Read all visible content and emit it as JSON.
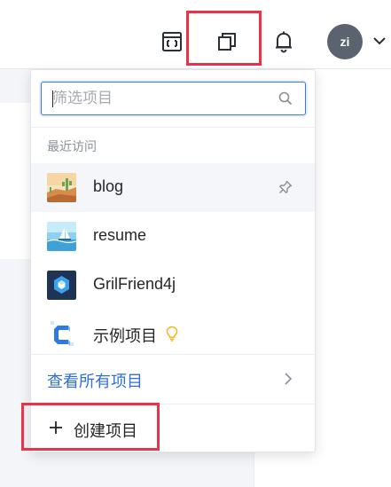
{
  "header": {
    "icons": [
      "frame-icon",
      "projects-icon",
      "bell-icon",
      "chevron-down-icon"
    ],
    "avatar_text": "zi"
  },
  "dropdown": {
    "search": {
      "placeholder": "筛选项目",
      "value": ""
    },
    "section_label": "最近访问",
    "items": [
      {
        "name": "blog",
        "thumb": "desert-cactus",
        "pinned": true
      },
      {
        "name": "resume",
        "thumb": "sea-sailboat"
      },
      {
        "name": "GrilFriend4j",
        "thumb": "blue-cube"
      },
      {
        "name": "示例项目",
        "thumb": "letter-c-blue",
        "badge": "bulb-icon"
      }
    ],
    "view_all_label": "查看所有项目",
    "create_label": "创建项目"
  },
  "colors": {
    "accent_blue": "#2f6fd6",
    "highlight_red": "#e8334a",
    "avatar_bg": "#5c6370",
    "bulb_yellow": "#f2b820"
  }
}
